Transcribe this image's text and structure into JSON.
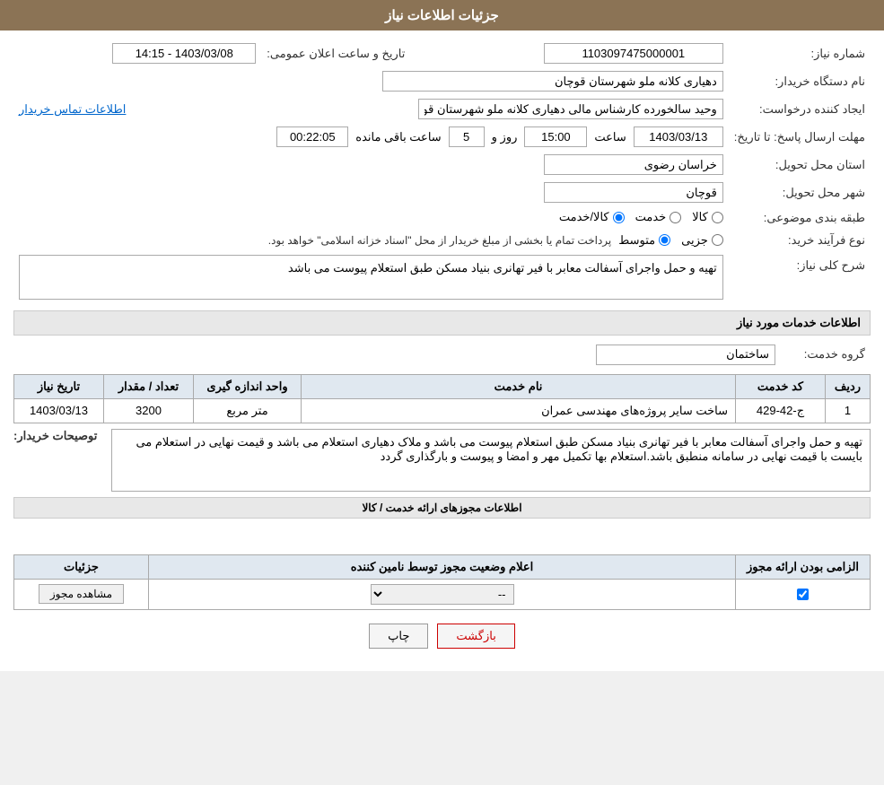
{
  "header": {
    "title": "جزئیات اطلاعات نیاز"
  },
  "fields": {
    "need_number_label": "شماره نیاز:",
    "need_number_value": "1103097475000001",
    "announcement_date_label": "تاریخ و ساعت اعلان عمومی:",
    "announcement_date_value": "1403/03/08 - 14:15",
    "buyer_org_label": "نام دستگاه خریدار:",
    "buyer_org_value": "دهیاری کلانه ملو شهرستان قوچان",
    "creator_label": "ایجاد کننده درخواست:",
    "creator_value": "وحید سالخورده کارشناس مالی دهیاری کلانه ملو شهرستان قوچان",
    "contact_info_link": "اطلاعات تماس خریدار",
    "response_deadline_label": "مهلت ارسال پاسخ: تا تاریخ:",
    "response_date_value": "1403/03/13",
    "response_time_label": "ساعت",
    "response_time_value": "15:00",
    "response_days_label": "روز و",
    "response_days_value": "5",
    "response_remaining_label": "ساعت باقی مانده",
    "response_remaining_value": "00:22:05",
    "delivery_province_label": "استان محل تحویل:",
    "delivery_province_value": "خراسان رضوی",
    "delivery_city_label": "شهر محل تحویل:",
    "delivery_city_value": "قوچان",
    "category_label": "طبقه بندی موضوعی:",
    "category_kala": "کالا",
    "category_khedmat": "خدمت",
    "category_kala_khedmat": "کالا/خدمت",
    "purchase_type_label": "نوع فرآیند خرید:",
    "purchase_jozyi": "جزیی",
    "purchase_motawaset": "متوسط",
    "purchase_note": "پرداخت تمام یا بخشی از مبلغ خریدار از محل \"اسناد خزانه اسلامی\" خواهد بود.",
    "need_description_label": "شرح کلی نیاز:",
    "need_description_value": "تهیه و حمل واجرای آسفالت معابر با فیر تهانری بنیاد مسکن طبق استعلام پیوست می باشد"
  },
  "services_section": {
    "title": "اطلاعات خدمات مورد نیاز",
    "service_group_label": "گروه خدمت:",
    "service_group_value": "ساختمان",
    "table_headers": {
      "row_num": "ردیف",
      "service_code": "کد خدمت",
      "service_name": "نام خدمت",
      "unit": "واحد اندازه گیری",
      "quantity": "تعداد / مقدار",
      "need_date": "تاریخ نیاز"
    },
    "rows": [
      {
        "row_num": "1",
        "service_code": "ج-42-429",
        "service_name": "ساخت سایر پروژه‌های مهندسی عمران",
        "unit": "متر مربع",
        "quantity": "3200",
        "need_date": "1403/03/13"
      }
    ]
  },
  "buyer_description": {
    "label": "توصیحات خریدار:",
    "value": "تهیه و حمل واجرای آسفالت معابر با فیر تهانری بنیاد مسکن طبق استعلام پیوست می باشد و ملاک دهیاری استعلام می باشد و قیمت نهایی در استعلام می بایست با قیمت نهایی در سامانه منطبق باشد.استعلام بها تکمیل مهر و امضا و پیوست و بارگذاری گردد"
  },
  "permissions_section": {
    "title": "اطلاعات مجوزهای ارائه خدمت / کالا",
    "table_headers": {
      "required": "الزامی بودن ارائه مجوز",
      "supplier_status": "اعلام وضعیت مجوز توسط نامین کننده",
      "details": "جزئیات"
    },
    "rows": [
      {
        "required_checked": true,
        "supplier_status": "--",
        "details_btn": "مشاهده مجوز"
      }
    ]
  },
  "buttons": {
    "print": "چاپ",
    "back": "بازگشت"
  }
}
